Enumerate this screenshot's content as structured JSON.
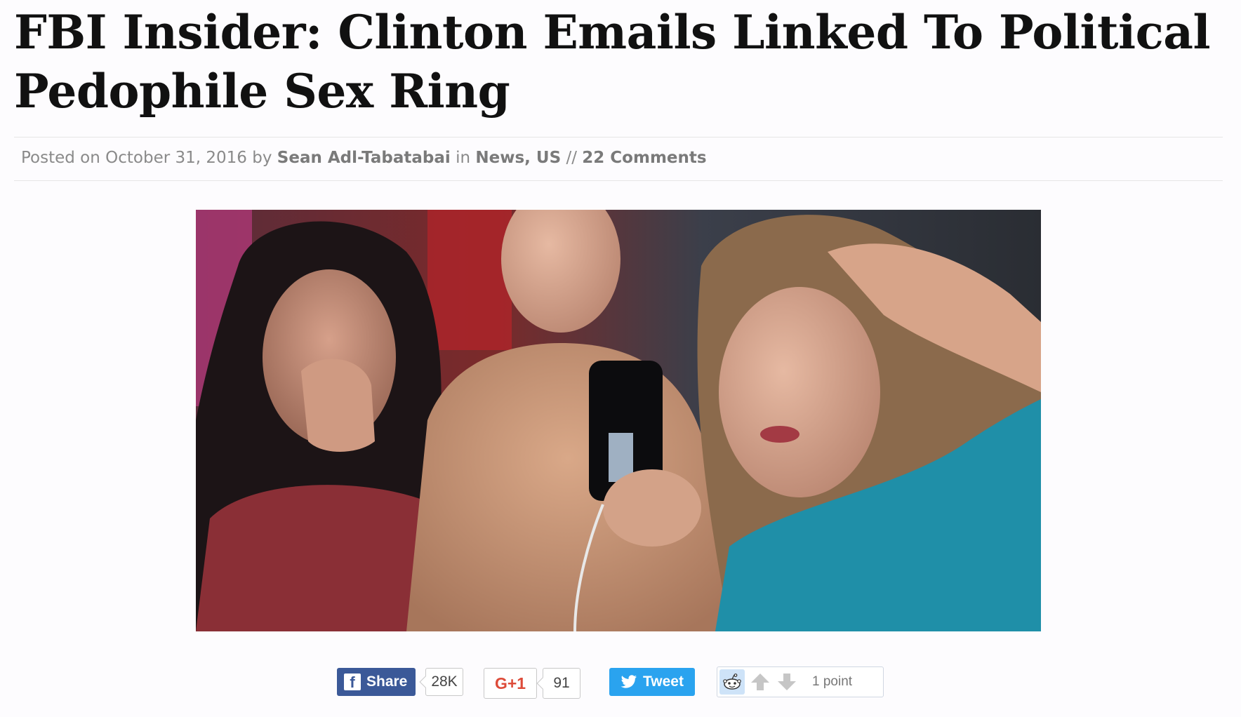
{
  "article": {
    "title_line1": "FBI Insider: Clinton Emails Linked To Political",
    "title_line2": "Pedophile Sex Ring",
    "meta": {
      "posted_prefix": "Posted on",
      "date": "October 31, 2016",
      "by": "by",
      "author": "Sean Adl-Tabatabai",
      "in": "in",
      "categories": "News, US",
      "separator": "//",
      "comments": "22 Comments"
    }
  },
  "share_bar": {
    "facebook": {
      "label": "Share",
      "count": "28K",
      "color": "#3b5998"
    },
    "google": {
      "label": "G+1",
      "count": "91",
      "color": "#dd4b39"
    },
    "twitter": {
      "label": "Tweet",
      "color": "#2aa3ef"
    },
    "reddit": {
      "points": "1 point"
    }
  }
}
